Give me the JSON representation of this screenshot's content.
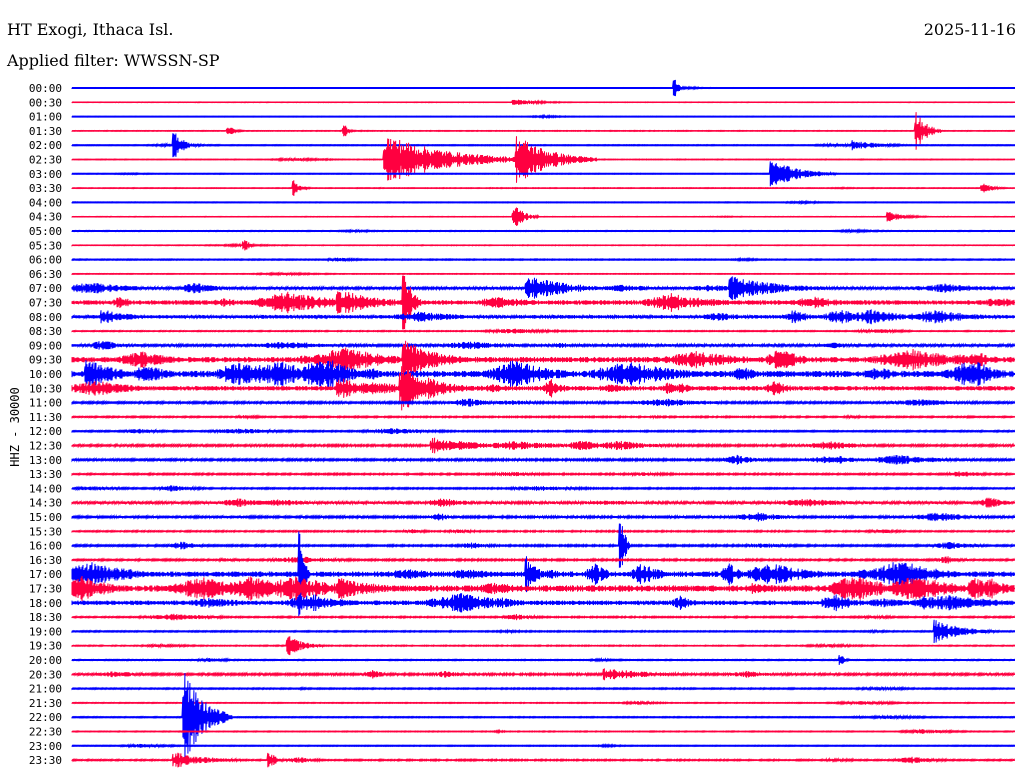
{
  "header": {
    "station": "HT Exogi, Ithaca Isl.",
    "date": "2025-11-16",
    "filter": "Applied filter: WWSSN-SP"
  },
  "chart_data": {
    "type": "line",
    "title": "HT Exogi, Ithaca Isl.",
    "ylabel": "HHZ - 30000",
    "minutes_per_line": 30,
    "colors": [
      "#0000ff",
      "#ff0040"
    ],
    "row_labels": [
      "00:00",
      "00:30",
      "01:00",
      "01:30",
      "02:00",
      "02:30",
      "03:00",
      "03:30",
      "04:00",
      "04:30",
      "05:00",
      "05:30",
      "06:00",
      "06:30",
      "07:00",
      "07:30",
      "08:00",
      "08:30",
      "09:00",
      "09:30",
      "10:00",
      "10:30",
      "11:00",
      "11:30",
      "12:00",
      "12:30",
      "13:00",
      "13:30",
      "14:00",
      "14:30",
      "15:00",
      "15:30",
      "16:00",
      "16:30",
      "17:00",
      "17:30",
      "18:00",
      "18:30",
      "19:00",
      "19:30",
      "20:00",
      "20:30",
      "21:00",
      "21:30",
      "22:00",
      "22:30",
      "23:00",
      "23:30"
    ],
    "activity": [
      0.3,
      0.3,
      0.3,
      0.4,
      0.5,
      0.4,
      0.4,
      0.4,
      0.4,
      0.3,
      0.5,
      0.4,
      0.6,
      0.4,
      1.5,
      2.5,
      2,
      0.6,
      1.5,
      3,
      3.5,
      2.5,
      1.2,
      0.8,
      0.8,
      1.2,
      1.2,
      0.9,
      0.8,
      1.5,
      1.2,
      0.8,
      1,
      1,
      3,
      3.5,
      2.5,
      0.8,
      0.7,
      0.6,
      0.6,
      1.2,
      0.7,
      0.5,
      0.6,
      0.5,
      0.5,
      0.8
    ],
    "events": [
      [
        0,
        19.2,
        10,
        0.1
      ],
      [
        1,
        14.1,
        3,
        0.8
      ],
      [
        3,
        26.9,
        20,
        0.3
      ],
      [
        3,
        5,
        5,
        0.2
      ],
      [
        3,
        8.7,
        6,
        0.1
      ],
      [
        4,
        3.3,
        12,
        0.3
      ],
      [
        4,
        24.9,
        5,
        0.8
      ],
      [
        5,
        10,
        26,
        1.8
      ],
      [
        5,
        14.2,
        25,
        1.0
      ],
      [
        6,
        22.3,
        15,
        0.8
      ],
      [
        7,
        7.1,
        8,
        0.2
      ],
      [
        7,
        29,
        5,
        0.3
      ],
      [
        9,
        14.1,
        12,
        0.3
      ],
      [
        9,
        26,
        5,
        0.5
      ],
      [
        11,
        5.5,
        6,
        0.2
      ],
      [
        14,
        14.5,
        14,
        1.2
      ],
      [
        14,
        21,
        12,
        1.5
      ],
      [
        15,
        8.5,
        14,
        1.2
      ],
      [
        15,
        10.6,
        40,
        0.2
      ],
      [
        16,
        1,
        8,
        0.8
      ],
      [
        19,
        10.6,
        20,
        1
      ],
      [
        20,
        0.5,
        15,
        1
      ],
      [
        21,
        10.5,
        25,
        1
      ],
      [
        21,
        8.5,
        12,
        0.8
      ],
      [
        25,
        11.5,
        8,
        1.5
      ],
      [
        34,
        7.3,
        45,
        0.1
      ],
      [
        34,
        14.5,
        18,
        0.3
      ],
      [
        35,
        8.5,
        12,
        1.2
      ],
      [
        32,
        17.5,
        35,
        0.1
      ],
      [
        38,
        27.5,
        12,
        0.8
      ],
      [
        39,
        6.9,
        10,
        0.5
      ],
      [
        40,
        24.5,
        5,
        0.1
      ],
      [
        41,
        17,
        6,
        1.5
      ],
      [
        44,
        3.6,
        45,
        0.6
      ],
      [
        47,
        3.3,
        8,
        1
      ],
      [
        47,
        6.3,
        10,
        0.2
      ]
    ]
  }
}
